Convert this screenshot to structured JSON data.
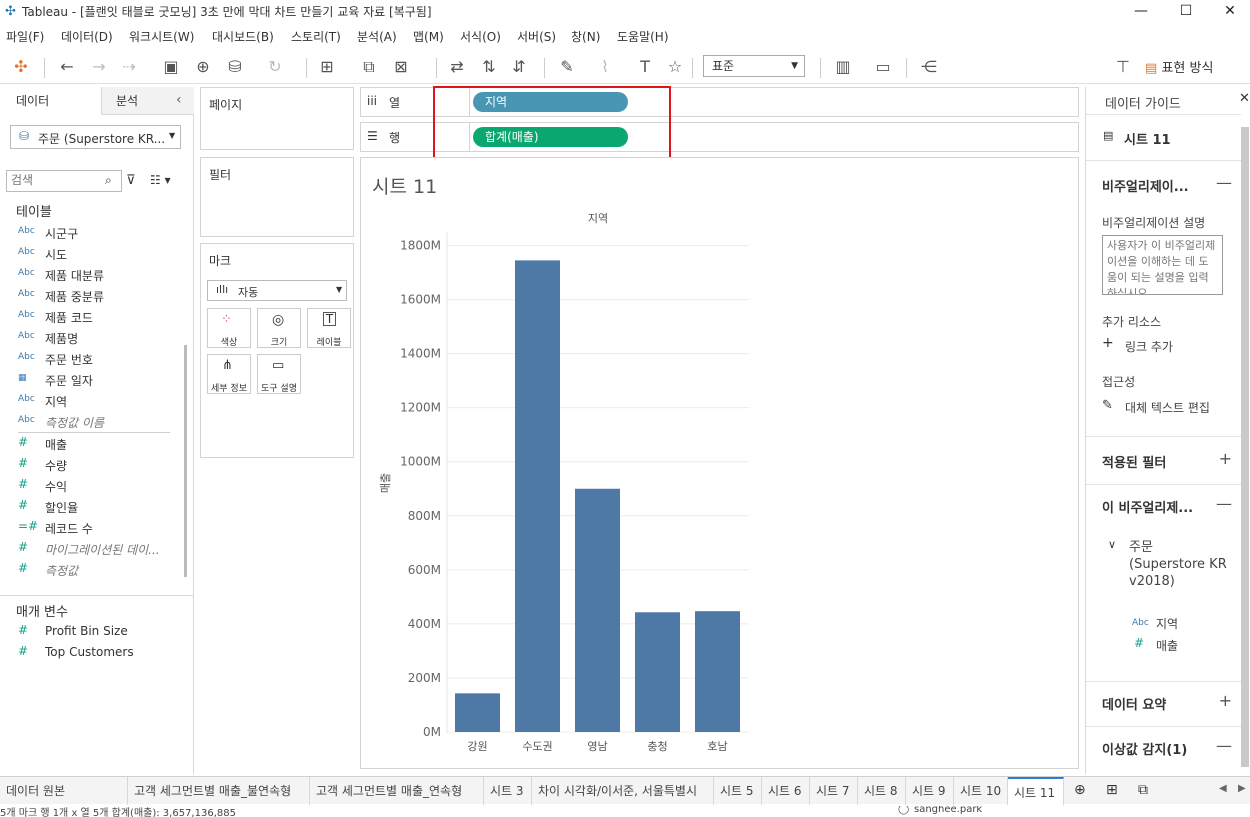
{
  "window": {
    "title": "Tableau - [플랜잇 태블로 굿모닝] 3초 만에 막대 차트 만들기 교육 자료 [복구됨]"
  },
  "menu": [
    "파일(F)",
    "데이터(D)",
    "워크시트(W)",
    "대시보드(B)",
    "스토리(T)",
    "분석(A)",
    "맵(M)",
    "서식(O)",
    "서버(S)",
    "창(N)",
    "도움말(H)"
  ],
  "toolbar": {
    "fit": "표준",
    "show_me": "표현 방식"
  },
  "left": {
    "tabs": [
      "데이터",
      "분석"
    ],
    "datasource": "주문 (Superstore KR...",
    "search_placeholder": "검색",
    "tables_header": "테이블",
    "dimensions": [
      {
        "icon": "Abc",
        "label": "시군구"
      },
      {
        "icon": "Abc",
        "label": "시도"
      },
      {
        "icon": "Abc",
        "label": "제품 대분류"
      },
      {
        "icon": "Abc",
        "label": "제품 중분류"
      },
      {
        "icon": "Abc",
        "label": "제품 코드"
      },
      {
        "icon": "Abc",
        "label": "제품명"
      },
      {
        "icon": "Abc",
        "label": "주문 번호"
      },
      {
        "icon": "calendar",
        "label": "주문 일자"
      },
      {
        "icon": "Abc",
        "label": "지역"
      },
      {
        "icon": "Abc",
        "label": "측정값 이름"
      }
    ],
    "measures": [
      {
        "icon": "#",
        "label": "매출"
      },
      {
        "icon": "#",
        "label": "수량"
      },
      {
        "icon": "#",
        "label": "수익"
      },
      {
        "icon": "#",
        "label": "할인율"
      },
      {
        "icon": "=#",
        "label": "레코드 수"
      },
      {
        "icon": "#",
        "label": "마이그레이션된 데이..."
      },
      {
        "icon": "#",
        "label": "측정값"
      }
    ],
    "params_header": "매개 변수",
    "params": [
      {
        "icon": "#",
        "label": "Profit Bin Size"
      },
      {
        "icon": "#",
        "label": "Top Customers"
      }
    ]
  },
  "cards": {
    "pages": "페이지",
    "filters": "필터",
    "marks": "마크",
    "mark_type": "자동",
    "mark_buttons": [
      "색상",
      "크기",
      "레이블",
      "세부 정보",
      "도구 설명"
    ]
  },
  "shelves": {
    "columns_label": "열",
    "rows_label": "행",
    "columns_pill": "지역",
    "rows_pill": "합계(매출)"
  },
  "sheet": {
    "title": "시트 11"
  },
  "chart_data": {
    "type": "bar",
    "title": "지역",
    "ylabel": "매출",
    "categories": [
      "강원",
      "수도권",
      "영남",
      "충청",
      "호남"
    ],
    "values": [
      143,
      1745,
      900,
      443,
      447
    ],
    "unit": "M",
    "ylim": [
      0,
      1850
    ],
    "yticks": [
      "0M",
      "200M",
      "400M",
      "600M",
      "800M",
      "1000M",
      "1200M",
      "1400M",
      "1600M",
      "1800M"
    ],
    "color": "#4e79a7",
    "grid": true
  },
  "right": {
    "title": "데이터 가이드",
    "sheet": "시트 11",
    "viz_section": "비주얼리제이...",
    "desc_label": "비주얼리제이션 설명",
    "desc_placeholder": "사용자가 이 비주얼리제이션을 이해하는 데 도움이 되는 설명을 입력하십시오.",
    "resources": "추가 리소스",
    "add_link": "링크 추가",
    "accessibility": "접근성",
    "alt_text": "대체 텍스트 편집",
    "filters": "적용된 필터",
    "this_viz": "이 비주얼리제...",
    "source": "주문 (Superstore KR v2018)",
    "fields": [
      {
        "icon": "Abc",
        "label": "지역"
      },
      {
        "icon": "#",
        "label": "매출"
      }
    ],
    "summary": "데이터 요약",
    "outliers": "이상값 감지(1)"
  },
  "tabs": [
    "데이터 원본",
    "고객 세그먼트별 매출_불연속형",
    "고객 세그먼트별 매출_연속형",
    "시트 3",
    "차이 시각화/이서준, 서울특별시",
    "시트 5",
    "시트 6",
    "시트 7",
    "시트 8",
    "시트 9",
    "시트 10",
    "시트 11"
  ],
  "status": "5개 마크    행 1개 x 열 5개    합계(매출): 3,657,136,885",
  "user": "sanghee.park"
}
